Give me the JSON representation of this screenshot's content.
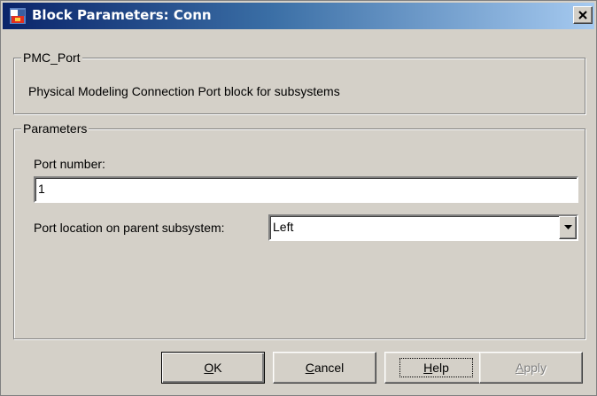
{
  "window": {
    "title": "Block Parameters: Conn",
    "icon": "simulink-block-icon",
    "close_icon": "close-icon"
  },
  "block_info": {
    "group_title": "PMC_Port",
    "description": "Physical Modeling Connection Port block for subsystems"
  },
  "parameters": {
    "group_title": "Parameters",
    "port_number_label": "Port number:",
    "port_number_value": "1",
    "port_location_label": "Port location on parent subsystem:",
    "port_location_value": "Left",
    "dropdown_icon": "chevron-down-icon"
  },
  "buttons": {
    "ok": {
      "mnemonic": "O",
      "rest": "K"
    },
    "cancel": {
      "mnemonic": "C",
      "rest": "ancel"
    },
    "help": {
      "mnemonic": "H",
      "rest": "elp"
    },
    "apply": {
      "mnemonic": "A",
      "rest": "pply",
      "disabled": true
    }
  },
  "colors": {
    "titlebar_start": "#0a246a",
    "titlebar_end": "#a6caf0",
    "face": "#d4d0c8"
  }
}
